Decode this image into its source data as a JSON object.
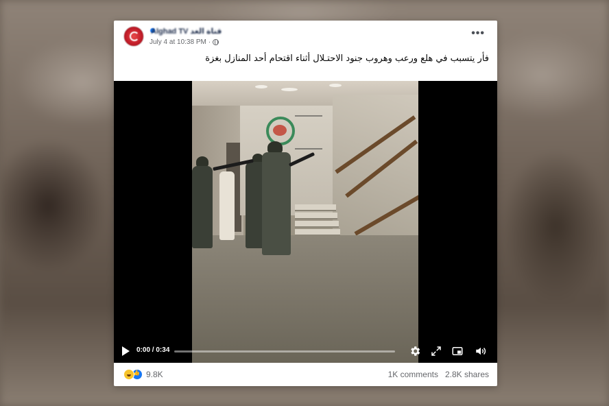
{
  "post": {
    "page_name": "Alghad TV قناة الغد",
    "timestamp": "July 4 at 10:38 PM",
    "more_label": "•••",
    "caption": "فأر يتسبب في هلع ورعب وهروب جنود الاحتـلال أثناء اقتحام أحد المنازل بغزة"
  },
  "video": {
    "current_time": "0:00",
    "duration": "0:34",
    "time_separator": " / ",
    "progress": 0.0
  },
  "footer": {
    "reaction_count": "9.8K",
    "comments": "1K comments",
    "shares": "2.8K shares"
  },
  "icons": [
    "haha-icon",
    "like-icon",
    "globe-icon",
    "play-icon",
    "settings-icon",
    "fullscreen-icon",
    "pip-icon",
    "volume-icon",
    "more-icon"
  ],
  "colors": {
    "brand": "#1877f2",
    "avatar": "#c41e2a",
    "text_secondary": "#65676b"
  }
}
